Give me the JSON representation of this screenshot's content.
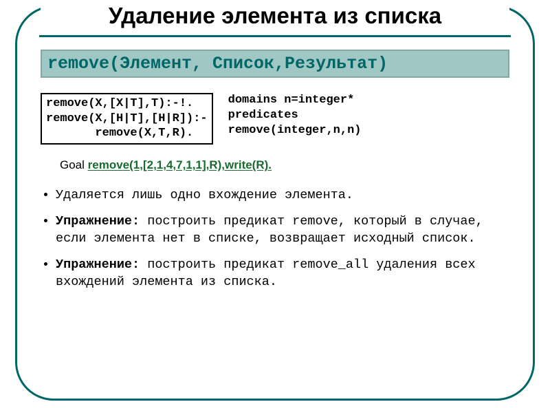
{
  "title": "Удаление элемента из списка",
  "banner": "remove(Элемент, Список,Результат)",
  "codebox": "remove(X,[X|T],T):-!.\nremove(X,[H|T],[H|R]):-\n       remove(X,T,R).",
  "decl": "domains n=integer*\npredicates\nremove(integer,n,n)",
  "goal_label": "Goal ",
  "goal_code": "remove(1,[2,1,4,7,1,1],R),write(R).",
  "bullets": {
    "b1": "Удаляется лишь одно вхождение элемента.",
    "b2_label": "Упражнение:",
    "b2_rest": " построить предикат remove, который в случае, если элемента нет в списке, возвращает исходный список.",
    "b3_label": "Упражнение:",
    "b3_rest": " построить предикат remove_all удаления всех вхождений элемента из списка."
  }
}
